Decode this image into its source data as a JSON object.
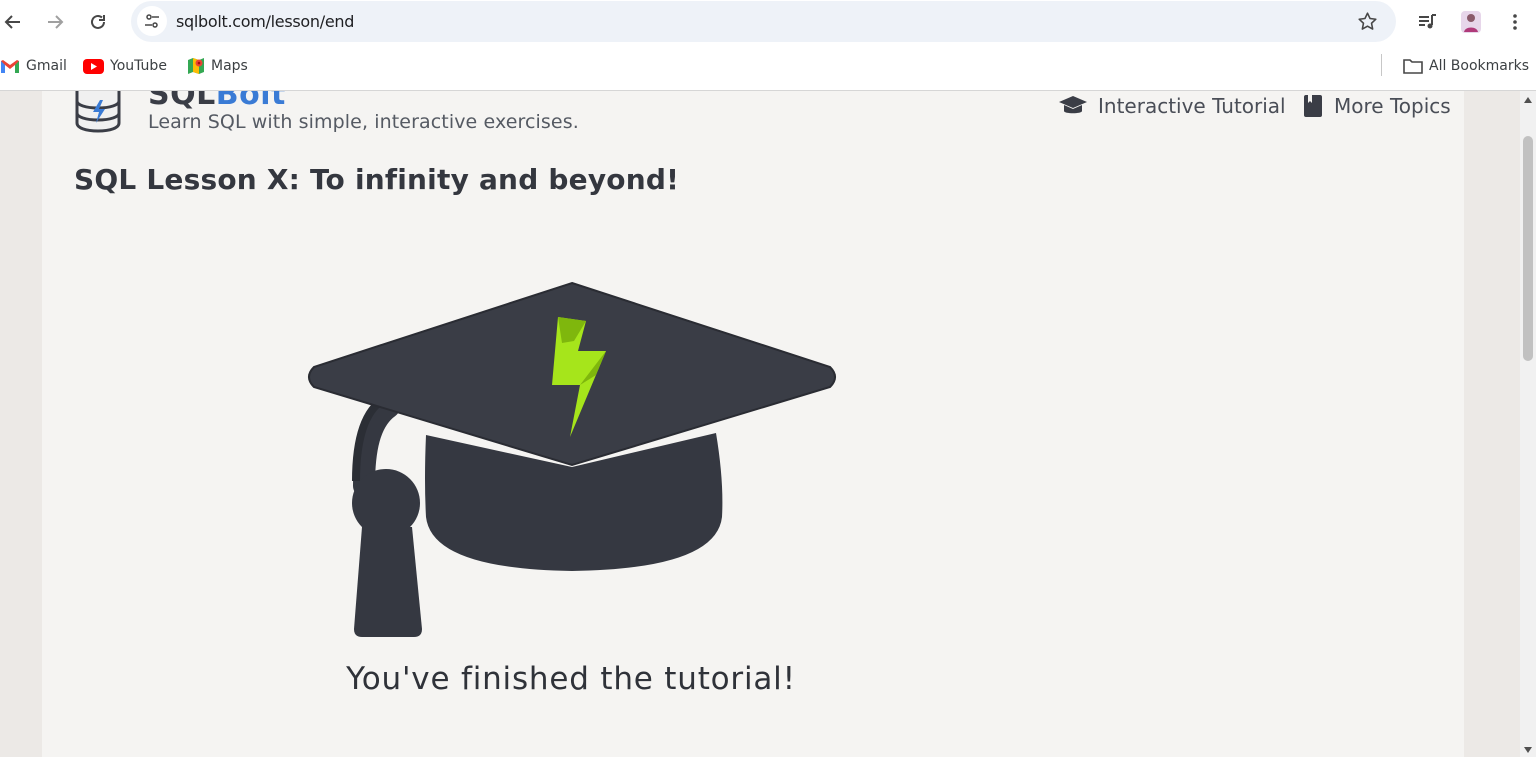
{
  "browser": {
    "url": "sqlbolt.com/lesson/end",
    "bookmarks": [
      {
        "label": "Gmail",
        "icon": "gmail-icon"
      },
      {
        "label": "YouTube",
        "icon": "youtube-icon"
      },
      {
        "label": "Maps",
        "icon": "maps-icon"
      }
    ],
    "all_bookmarks_label": "All Bookmarks"
  },
  "site": {
    "brand_part1": "SQL",
    "brand_part2": "Bolt",
    "tagline": "Learn SQL with simple, interactive exercises.",
    "nav": {
      "tutorial_label": "Interactive Tutorial",
      "topics_label": "More Topics"
    }
  },
  "lesson": {
    "title": "SQL Lesson X: To infinity and beyond!",
    "finished_text": "You've finished the tutorial!"
  },
  "colors": {
    "accent": "#3a7bd5",
    "cap": "#353841",
    "bolt": "#a6e51b"
  }
}
